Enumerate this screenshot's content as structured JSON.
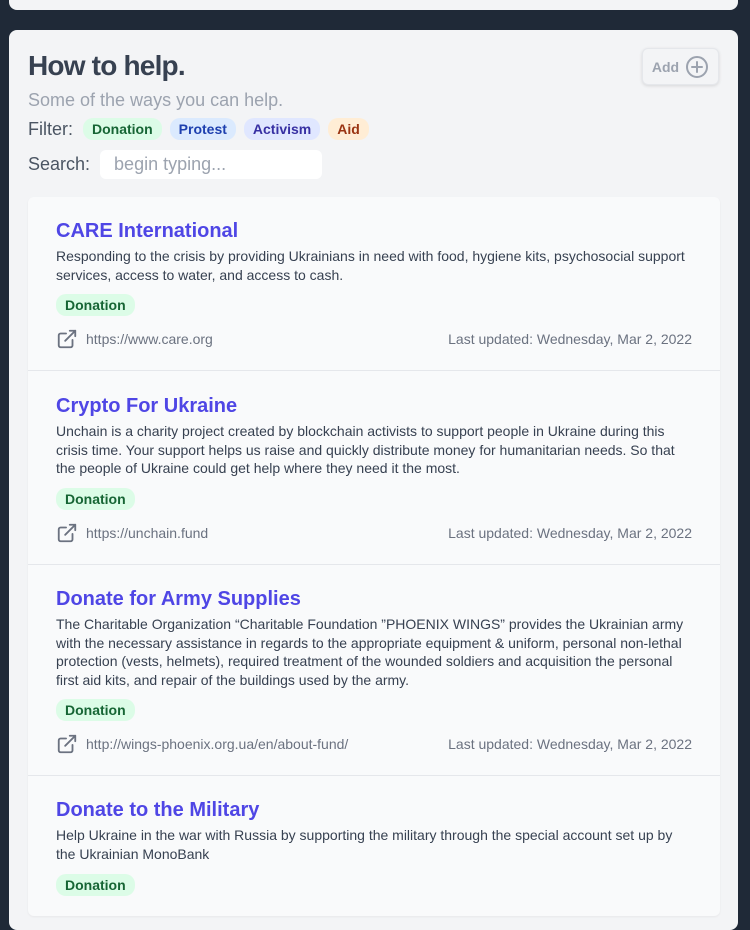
{
  "header": {
    "title": "How to help.",
    "subtitle": "Some of the ways you can help.",
    "add_label": "Add"
  },
  "filter": {
    "label": "Filter:",
    "tags": [
      "Donation",
      "Protest",
      "Activism",
      "Aid"
    ]
  },
  "search": {
    "label": "Search:",
    "placeholder": "begin typing..."
  },
  "items": [
    {
      "title": "CARE International",
      "description": "Responding to the crisis by providing Ukrainians in need with food, hygiene kits, psychosocial support services, access to water, and access to cash.",
      "tag": "Donation",
      "url": "https://www.care.org",
      "updated": "Last updated: Wednesday, Mar 2, 2022"
    },
    {
      "title": "Crypto For Ukraine",
      "description": "Unchain is a charity project created by blockchain activists to support people in Ukraine during this crisis time. Your support helps us raise and quickly distribute money for humanitarian needs. So that the people of Ukraine could get help where they need it the most.",
      "tag": "Donation",
      "url": "https://unchain.fund",
      "updated": "Last updated: Wednesday, Mar 2, 2022"
    },
    {
      "title": "Donate for Army Supplies",
      "description": "The Charitable Organization “Charitable Foundation ”PHOENIX WINGS” provides the Ukrainian army with the necessary assistance in regards to the appropriate equipment & uniform, personal non-lethal protection (vests, helmets), required treatment of the wounded soldiers and acquisition the personal first aid kits, and repair of the buildings used by the army.",
      "tag": "Donation",
      "url": "http://wings-phoenix.org.ua/en/about-fund/",
      "updated": "Last updated: Wednesday, Mar 2, 2022"
    },
    {
      "title": "Donate to the Military",
      "description": "Help Ukraine in the war with Russia by supporting the military through the special account set up by the Ukrainian MonoBank",
      "tag": "Donation"
    }
  ]
}
